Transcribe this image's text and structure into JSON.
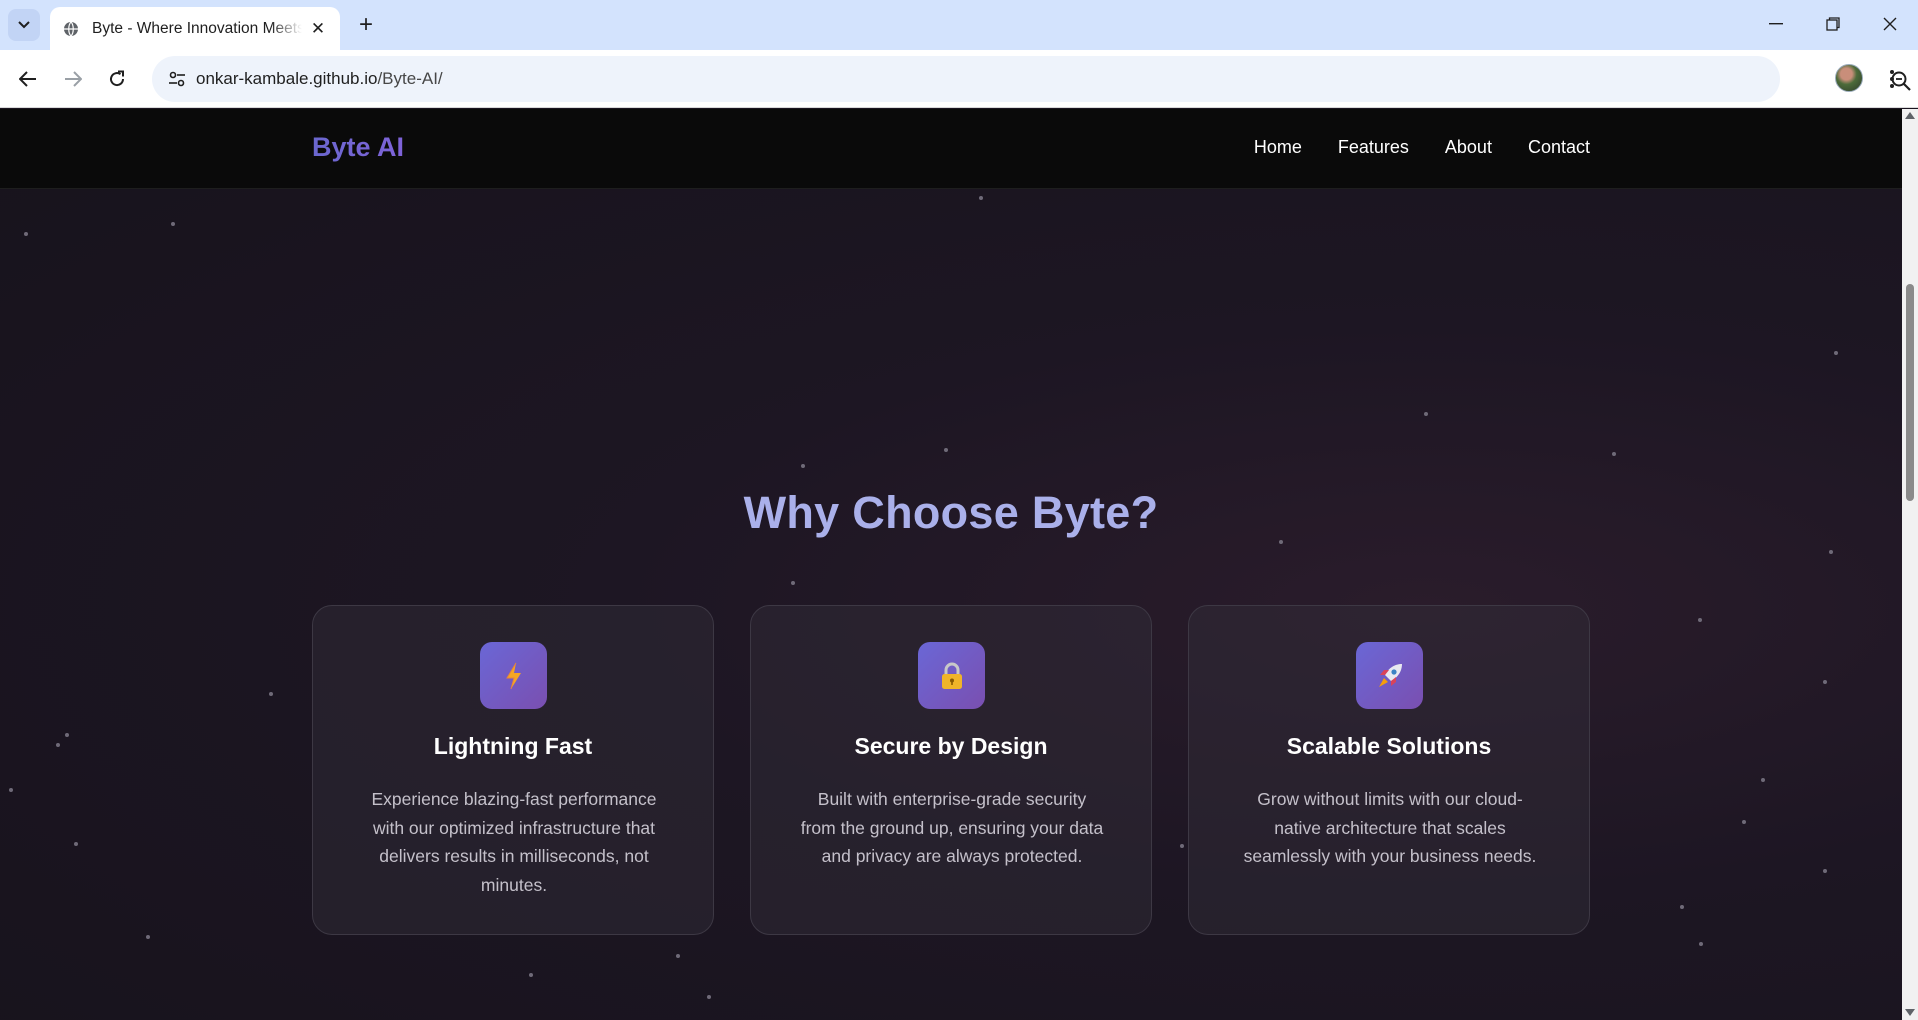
{
  "browser": {
    "tab_title": "Byte - Where Innovation Meets",
    "url_host": "onkar-kambale.github.io",
    "url_path": "/Byte-AI/",
    "tab_close_glyph": "✕",
    "new_tab_glyph": "+"
  },
  "site": {
    "logo": "Byte AI",
    "nav": [
      "Home",
      "Features",
      "About",
      "Contact"
    ]
  },
  "features": {
    "title": "Why Choose Byte?",
    "cards": [
      {
        "icon": "lightning-icon",
        "title": "Lightning Fast",
        "text": "Experience blazing-fast performance with our optimized infrastructure that delivers results in milliseconds, not minutes."
      },
      {
        "icon": "lock-icon",
        "title": "Secure by Design",
        "text": "Built with enterprise-grade security from the ground up, ensuring your data and privacy are always protected."
      },
      {
        "icon": "rocket-icon",
        "title": "Scalable Solutions",
        "text": "Grow without limits with our cloud-native architecture that scales seamlessly with your business needs."
      }
    ]
  },
  "colors": {
    "logo": "#6a67ce",
    "title": "#aab0ea",
    "nav_bg": "#0a0a0a",
    "page_bg": "#1d1623",
    "icon_gradient": [
      "#6a67d6",
      "#7a4fb0"
    ]
  }
}
